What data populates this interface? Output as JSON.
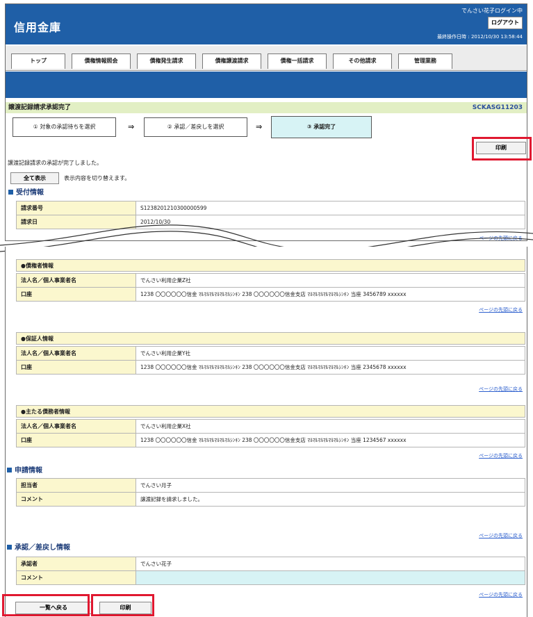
{
  "header": {
    "bank": "信用金庫",
    "user": "でんさい花子ログイン中",
    "logout": "ログアウト",
    "lastop": "最終操作日時 : 2012/10/30 13:58:44"
  },
  "tabs": [
    "トップ",
    "債権情報照会",
    "債権発生請求",
    "債権譲渡請求",
    "債権一括請求",
    "その他請求",
    "管理業務"
  ],
  "title": {
    "text": "譲渡記録請求承認完了",
    "code": "SCKASG11203"
  },
  "steps": [
    "① 対象の承認待ちを選択",
    "② 承認／差戻しを選択",
    "③ 承認完了"
  ],
  "arrow": "⇒",
  "print_label": "印刷",
  "message": "譲渡記録請求の承認が完了しました。",
  "toggle": {
    "button": "全て表示",
    "note": "表示内容を切り替えます。"
  },
  "reception": {
    "heading": "受付情報",
    "rows": [
      {
        "label": "請求番号",
        "value": "S1238201210300000599"
      },
      {
        "label": "請求日",
        "value": "2012/10/30"
      }
    ]
  },
  "pagetop": "ページの先頭に戻る",
  "creditor": {
    "heading": "●債権者情報",
    "rows": [
      {
        "label": "法人名／個人事業者名",
        "value": "でんさい利用企業Z社"
      },
      {
        "label": "口座",
        "value": "1238 〇〇〇〇〇〇信金 ﾏﾙﾏﾙﾏﾙﾏﾙﾏﾙﾏﾙｼﾝｷﾝ 238 〇〇〇〇〇〇信金支店 ﾏﾙﾏﾙﾏﾙﾏﾙﾏﾙﾏﾙｼﾝｷﾝ 当座 3456789 xxxxxx"
      }
    ]
  },
  "guarantor": {
    "heading": "●保証人情報",
    "rows": [
      {
        "label": "法人名／個人事業者名",
        "value": "でんさい利用企業Y社"
      },
      {
        "label": "口座",
        "value": "1238 〇〇〇〇〇〇信金 ﾏﾙﾏﾙﾏﾙﾏﾙﾏﾙﾏﾙｼﾝｷﾝ 238 〇〇〇〇〇〇信金支店 ﾏﾙﾏﾙﾏﾙﾏﾙﾏﾙﾏﾙｼﾝｷﾝ 当座 2345678 xxxxxx"
      }
    ]
  },
  "debtor": {
    "heading": "●主たる債務者情報",
    "rows": [
      {
        "label": "法人名／個人事業者名",
        "value": "でんさい利用企業X社"
      },
      {
        "label": "口座",
        "value": "1238 〇〇〇〇〇〇信金 ﾏﾙﾏﾙﾏﾙﾏﾙﾏﾙﾏﾙｼﾝｷﾝ 238 〇〇〇〇〇〇信金支店 ﾏﾙﾏﾙﾏﾙﾏﾙﾏﾙﾏﾙｼﾝｷﾝ 当座 1234567 xxxxxx"
      }
    ]
  },
  "application": {
    "heading": "申請情報",
    "rows": [
      {
        "label": "担当者",
        "value": "でんさい月子"
      },
      {
        "label": "コメント",
        "value": "譲渡記録を請求しました。"
      }
    ]
  },
  "approval": {
    "heading": "承認／差戻し情報",
    "rows": [
      {
        "label": "承認者",
        "value": "でんさい花子"
      },
      {
        "label": "コメント",
        "value": ""
      }
    ]
  },
  "back_label": "一覧へ戻る"
}
